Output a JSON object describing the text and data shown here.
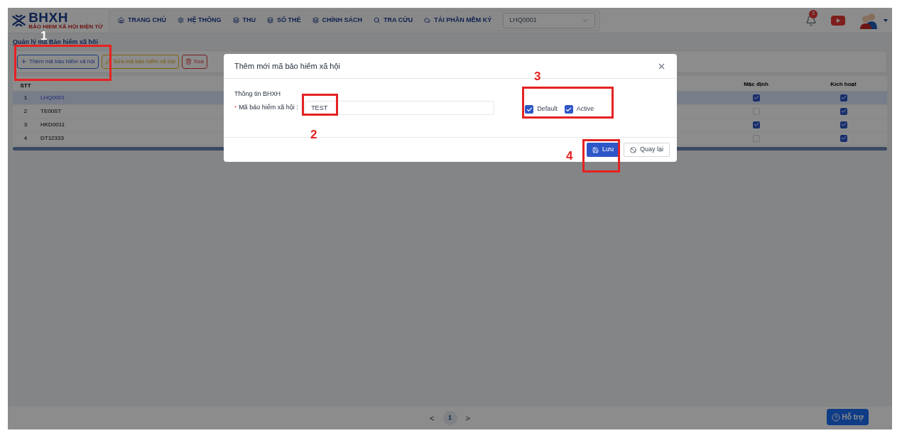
{
  "header": {
    "logo": "BHXH",
    "logo_sub": "BẢO HIỂM XÃ HỘI ĐIỆN TỬ",
    "nav": [
      {
        "label": "TRANG CHỦ",
        "kind": "home"
      },
      {
        "label": "HỆ THỐNG",
        "kind": "gear"
      },
      {
        "label": "THU",
        "kind": "stack"
      },
      {
        "label": "SỐ THẺ",
        "kind": "stack"
      },
      {
        "label": "CHÍNH SÁCH",
        "kind": "stack"
      },
      {
        "label": "TRA CỨU",
        "kind": "search"
      },
      {
        "label": "TẢI PHẦN MỀM KÝ",
        "kind": "cloud"
      }
    ],
    "unit_select": "LHQ0001",
    "notification_count": "3"
  },
  "breadcrumb": "Quản lý mã Bảo hiểm xã hội",
  "toolbar": [
    {
      "label": "Thêm mã bảo hiểm xã hội",
      "kind": "add"
    },
    {
      "label": "Sửa mã bảo hiểm xã hội",
      "kind": "edit"
    },
    {
      "label": "Xoá",
      "kind": "delete"
    }
  ],
  "table": {
    "columns": [
      "STT",
      "Mặc định",
      "Kích hoạt"
    ],
    "rows": [
      {
        "stt": "1",
        "code": "LHQ0001",
        "default": true,
        "active": true,
        "selected": true
      },
      {
        "stt": "2",
        "code": "TE00ST",
        "default": false,
        "active": true,
        "selected": false
      },
      {
        "stt": "3",
        "code": "HKD0011",
        "default": true,
        "active": true,
        "selected": false
      },
      {
        "stt": "4",
        "code": "DT12333",
        "default": false,
        "active": true,
        "selected": false
      }
    ]
  },
  "pagination": {
    "prev": "<",
    "page": "1",
    "next": ">"
  },
  "help_button": "Hỗ trợ",
  "modal": {
    "title": "Thêm mới mã bảo hiểm xã hội",
    "section": "Thông tin BHXH",
    "required": "*",
    "field_label": "Mã bảo hiểm xã hội :",
    "field_value": "TEST",
    "checkboxes": [
      {
        "label": "Default",
        "checked": true
      },
      {
        "label": "Active",
        "checked": true
      }
    ],
    "save": "Lưu",
    "back": "Quay lại"
  },
  "annotations": [
    {
      "label": "1"
    },
    {
      "label": "2"
    },
    {
      "label": "3"
    },
    {
      "label": "4"
    }
  ]
}
